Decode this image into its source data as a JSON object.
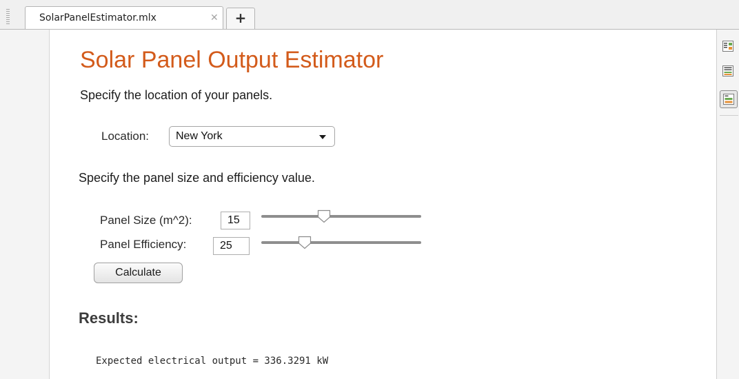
{
  "tabs": {
    "active_tab": "SolarPanelEstimator.mlx",
    "close_glyph": "✕",
    "add_glyph": "+"
  },
  "document": {
    "title": "Solar Panel Output Estimator",
    "intro_location": "Specify the location of your panels.",
    "location": {
      "label": "Location:",
      "selected": "New York"
    },
    "intro_panel": "Specify the panel size and efficiency value.",
    "panel_size": {
      "label": "Panel Size (m^2):",
      "value": "15",
      "slider_fraction": 0.38
    },
    "panel_efficiency": {
      "label": "Panel Efficiency:",
      "value": "25",
      "slider_fraction": 0.25
    },
    "calculate_label": "Calculate",
    "results_heading": "Results:",
    "output_text": "Expected electrical output = 336.3291 kW"
  },
  "right_toolbar": {
    "icons": [
      "output-inline-icon",
      "output-right-icon",
      "hide-code-icon"
    ],
    "active_icon": "hide-code-icon"
  },
  "colors": {
    "title": "#d35b1b",
    "heading": "#3c3c3c"
  }
}
